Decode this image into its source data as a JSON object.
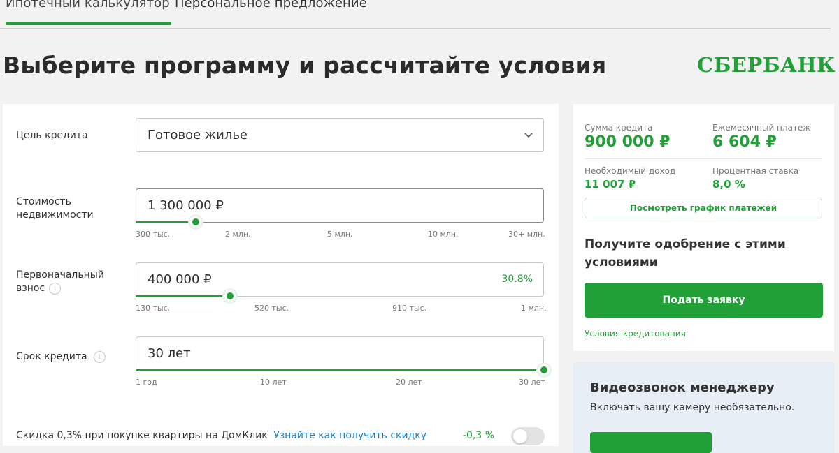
{
  "tabs": [
    {
      "label": "Ипотечный калькулятор",
      "active": true
    },
    {
      "label": "Персональное предложение",
      "active": false
    }
  ],
  "page_title": "Выберите программу и рассчитайте условия",
  "logo": {
    "text": "СБЕРБАНК",
    "icon": "sberbank-logo-icon",
    "color": "#21a038"
  },
  "form": {
    "purpose": {
      "label": "Цель кредита",
      "value": "Готовое жилье"
    },
    "cost": {
      "label_line1": "Стоимость",
      "label_line2": "недвижимости",
      "value": "1 300 000 ₽",
      "slider_fraction": 0.147,
      "ticks": [
        "300 тыс.",
        "2 млн.",
        "5 млн.",
        "10 млн.",
        "30+ млн."
      ]
    },
    "down_payment": {
      "label_line1": "Первоначальный",
      "label_line2": "взнос",
      "value": "400 000 ₽",
      "percent": "30.8%",
      "slider_fraction": 0.232,
      "ticks": [
        "130 тыс.",
        "520 тыс.",
        "910 тыс.",
        "1 млн."
      ]
    },
    "term": {
      "label": "Срок кредита",
      "value": "30 лет",
      "slider_fraction": 1.0,
      "ticks": [
        "1 год",
        "10 лет",
        "20 лет",
        "30 лет"
      ]
    },
    "discount": {
      "text": "Скидка 0,3% при покупке квартиры на ДомКлик",
      "link": "Узнайте как получить скидку",
      "value": "-0,3 %",
      "toggle_on": false
    }
  },
  "summary": {
    "loan_amount_label": "Сумма кредита",
    "loan_amount": "900 000 ₽",
    "monthly_payment_label": "Ежемесячный платеж",
    "monthly_payment": "6 604 ₽",
    "required_income_label": "Необходимый доход",
    "required_income": "11 007 ₽",
    "rate_label": "Процентная ставка",
    "rate": "8,0 %",
    "schedule_button": "Посмотреть график платежей",
    "approval_text": "Получите одобрение с этими условиями",
    "apply_button": "Подать заявку",
    "terms_link": "Условия кредитования"
  },
  "video": {
    "title": "Видеозвонок менеджеру",
    "subtitle": "Включать вашу камеру необязательно."
  },
  "colors": {
    "accent": "#21a038",
    "link": "#1a7fc7"
  }
}
